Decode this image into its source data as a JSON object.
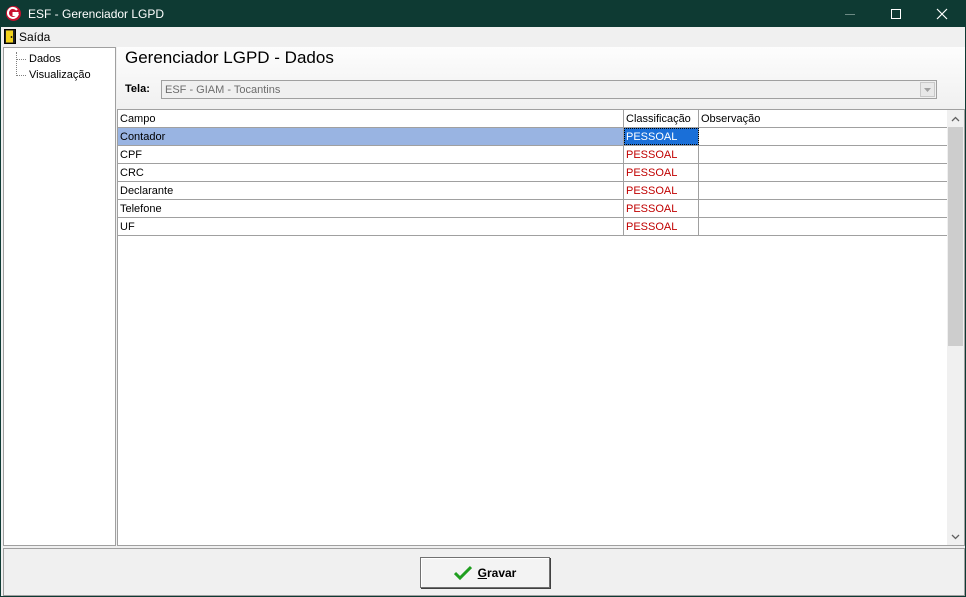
{
  "window": {
    "title": "ESF - Gerenciador LGPD"
  },
  "menu": {
    "exit_label": "Saída"
  },
  "sidebar": {
    "items": [
      {
        "label": "Dados"
      },
      {
        "label": "Visualização"
      }
    ]
  },
  "main": {
    "page_title": "Gerenciador LGPD - Dados",
    "tela_label": "Tela:",
    "tela_value": "ESF - GIAM - Tocantins"
  },
  "grid": {
    "columns": [
      "Campo",
      "Classificação",
      "Observação"
    ],
    "rows": [
      {
        "campo": "Contador",
        "classificacao": "PESSOAL",
        "observacao": ""
      },
      {
        "campo": "CPF",
        "classificacao": "PESSOAL",
        "observacao": ""
      },
      {
        "campo": "CRC",
        "classificacao": "PESSOAL",
        "observacao": ""
      },
      {
        "campo": "Declarante",
        "classificacao": "PESSOAL",
        "observacao": ""
      },
      {
        "campo": "Telefone",
        "classificacao": "PESSOAL",
        "observacao": ""
      },
      {
        "campo": "UF",
        "classificacao": "PESSOAL",
        "observacao": ""
      }
    ],
    "selected_row": 0
  },
  "footer": {
    "save_label": "Gravar"
  },
  "colors": {
    "titlebar": "#0e3a33",
    "selection_row": "#99b4e2",
    "selection_cell": "#1a6fd8",
    "classification_text": "#c00000",
    "check_icon": "#1f9e1f"
  }
}
